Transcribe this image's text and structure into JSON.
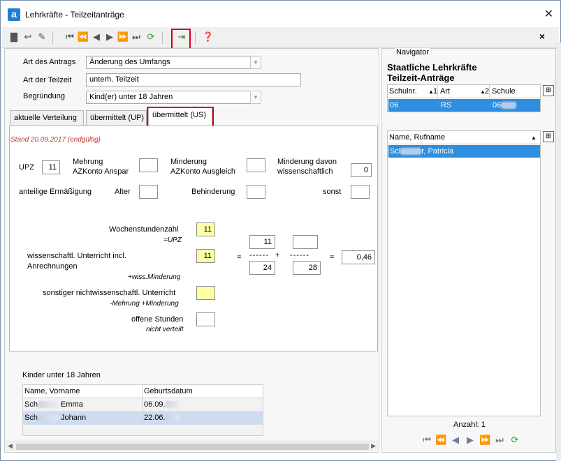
{
  "window": {
    "title": "Lehrkräfte - Teilzeitanträge",
    "app_icon": "a"
  },
  "toolbar": {
    "close_label": "×"
  },
  "form": {
    "art_antrag_label": "Art des Antrags",
    "art_antrag_value": "Änderung des Umfangs",
    "art_teilzeit_label": "Art der Teilzeit",
    "art_teilzeit_value": "unterh. Teilzeit",
    "begruendung_label": "Begründung",
    "begruendung_value": "Kind(er) unter 18 Jahren"
  },
  "tabs": [
    {
      "label": "aktuelle Verteilung"
    },
    {
      "label": "übermittelt (UP)"
    },
    {
      "label": "übermittelt (US)"
    }
  ],
  "panel": {
    "stand": "Stand 20.09.2017 (endgültig)",
    "upz_label": "UPZ",
    "upz_value": "11",
    "mehrung_label_1": "Mehrung",
    "mehrung_label_2": "AZKonto Anspar",
    "minderung_label_1": "Minderung",
    "minderung_label_2": "AZKonto Ausgleich",
    "minderung_wiss_label_1": "Minderung davon",
    "minderung_wiss_label_2": "wissenschaftlich",
    "minderung_wiss_value": "0",
    "anteilige_label": "anteilige Ermäßigung",
    "alter_label": "Alter",
    "behinderung_label": "Behinderung",
    "sonst_label": "sonst",
    "wochenstunden_label": "Wochenstundenzahl",
    "wochenstunden_sub": "=UPZ",
    "wochenstunden_value": "11",
    "wiss_label_1": "wissenschaftl. Unterricht incl.",
    "wiss_label_2": "Anrechnungen",
    "wiss_sub": "+wiss.Minderung",
    "wiss_value": "11",
    "frac1_num": "11",
    "frac1_den": "24",
    "frac2_num": "",
    "frac2_den": "28",
    "result": "0,46",
    "eq1": "=",
    "plus": "+",
    "eq2": "=",
    "dashes": "------",
    "sonstiger_label": "sonstiger nichtwissenschaftl. Unterricht",
    "sonstiger_sub": "-Mehrung +Minderung",
    "offene_label": "offene Stunden",
    "offene_sub": "nicht verteilt"
  },
  "kinder": {
    "title": "Kinder unter 18 Jahren",
    "columns": [
      "Name, Vorname",
      "Geburtsdatum"
    ],
    "rows": [
      {
        "name_prefix": "Sch",
        "vorname": "Emma",
        "datum": "06.09."
      },
      {
        "name_prefix": "Sch",
        "vorname": "Johann",
        "datum": "22.06."
      }
    ]
  },
  "navigator": {
    "legend": "Navigator",
    "title_1": "Staatliche Lehrkräfte",
    "title_2": "Teilzeit-Anträge",
    "grid1_columns": [
      "Schulnr.",
      "Art",
      "Schule"
    ],
    "grid1_sort": [
      "1",
      "2"
    ],
    "grid1_row": [
      "06",
      "RS",
      "06"
    ],
    "grid2_column": "Name, Rufname",
    "grid2_row_prefix": "Scl",
    "grid2_row_suffix": "r, Patricia",
    "anzahl": "Anzahl: 1"
  }
}
